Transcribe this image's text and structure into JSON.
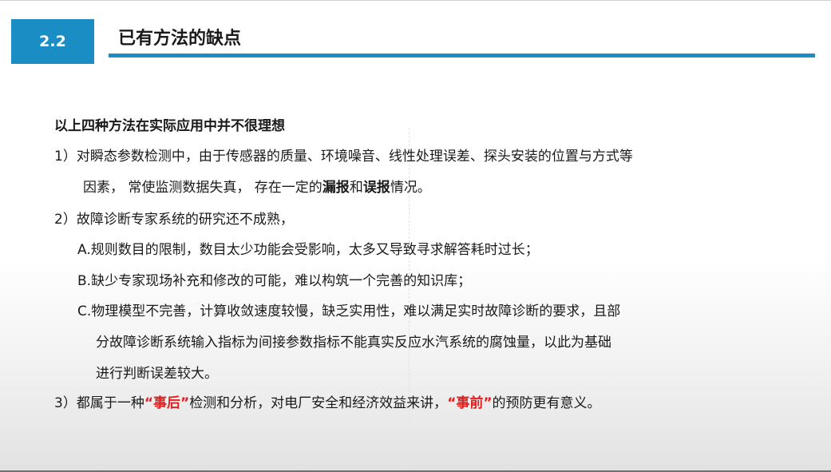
{
  "header": {
    "section_number": "2.2",
    "title": "已有方法的缺点"
  },
  "body": {
    "intro": "以上四种方法在实际应用中并不很理想",
    "item1": {
      "line1": "1）对瞬态参数检测中，由于传感器的质量、环境噪音、线性处理误差、探头安装的位置与方式等",
      "line2_prefix": "因素， 常使监测数据失真， 存在一定的",
      "kw_missed": "漏报",
      "and": "和",
      "kw_false": "误报",
      "line2_suffix": "情况。"
    },
    "item2": {
      "heading": "2）故障诊断专家系统的研究还不成熟，",
      "a": "A.规则数目的限制，数目太少功能会受影响，太多又导致寻求解答耗时过长；",
      "b": "B.缺少专家现场补充和修改的可能，难以构筑一个完善的知识库；",
      "c_line1": "C.物理模型不完善，计算收敛速度较慢，缺乏实用性，难以满足实时故障诊断的要求，且部",
      "c_line2": "分故障诊断系统输入指标为间接参数指标不能真实反应水汽系统的腐蚀量，以此为基础",
      "c_line3": "进行判断误差较大。"
    },
    "item3": {
      "prefix": "3）都属于一种",
      "kw_after": "“事后”",
      "middle": "检测和分析，对电厂安全和经济效益来讲，",
      "kw_before": "“事前”",
      "suffix": "的预防更有意义。"
    }
  },
  "colors": {
    "accent": "#1a8ec4",
    "highlight": "#e02020"
  }
}
